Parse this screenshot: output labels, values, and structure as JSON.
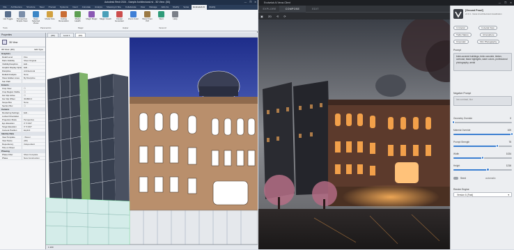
{
  "revit": {
    "title": "Autodesk Revit 2024 - Sample Architectural.rvt - 3D View: {3D}",
    "window_buttons": [
      "—",
      "❐",
      "✕"
    ],
    "tabs": [
      "File",
      "Architecture",
      "Structure",
      "Steel",
      "Precast",
      "Systems",
      "Insert",
      "Annotate",
      "Analyze",
      "Massing & Site",
      "Collaborate",
      "View",
      "Manage",
      "Add-Ins",
      "Modify",
      "Veras",
      "Evolvelab AI",
      "Modify"
    ],
    "active_tab": "Evolvelab AI",
    "ribbon_buttons": [
      {
        "label": "Hot Toggle",
        "color": "#5a6f8d"
      },
      {
        "label": "Perspective Simple View",
        "color": "#7b8ea9"
      },
      {
        "label": "Open Selected Views",
        "color": "#3b86c6"
      },
      {
        "label": "Model Size",
        "color": "#d2a13f"
      },
      {
        "label": "Ceiling Renovation",
        "color": "#c96d34"
      },
      {
        "label": "Model Health",
        "color": "#5d9f52"
      },
      {
        "label": "Magic Magic",
        "color": "#8a57b3"
      },
      {
        "label": "Magic Coach",
        "color": "#4a9fb8"
      },
      {
        "label": "Cluster Generator",
        "color": "#cc4d4d"
      },
      {
        "label": "Zoom Color",
        "color": "#3f7fd6"
      },
      {
        "label": "Show From Pdf",
        "color": "#9b7a45"
      },
      {
        "label": "Start",
        "color": "#2e9b79"
      },
      {
        "label": "Help",
        "color": "#7a7f88"
      }
    ],
    "ribbon_groups": [
      "Tools",
      "Parametrics",
      "Magic",
      "Helper",
      "Veras AI"
    ],
    "properties": {
      "header": "Properties",
      "type_name": "3D View",
      "selector": "3D View: {3D}",
      "edit_type": "Edit Type",
      "groups": [
        {
          "name": "Graphics",
          "rows": [
            [
              "Detail Level",
              "Fine"
            ],
            [
              "Parts Visibility",
              "Show Original"
            ],
            [
              "Visibility/Graphics",
              "Edit..."
            ],
            [
              "Graphic Display Options",
              "Edit..."
            ],
            [
              "Discipline",
              "Architectural"
            ],
            [
              "Default Analysis",
              "None"
            ],
            [
              "Show Hidden Lines",
              "By Discipline"
            ],
            [
              "Sun Path",
              ""
            ]
          ]
        },
        {
          "name": "Extents",
          "rows": [
            [
              "Crop View",
              "☐"
            ],
            [
              "Crop Region Visible",
              "☐"
            ],
            [
              "Far Clip Active",
              "☐"
            ],
            [
              "Far Clip Offset",
              "304800.0"
            ],
            [
              "Scope Box",
              "None"
            ],
            [
              "Section Box",
              "☐"
            ]
          ]
        },
        {
          "name": "Camera",
          "rows": [
            [
              "Rendering Settings",
              "Edit..."
            ],
            [
              "Locked Orientation",
              ""
            ],
            [
              "Projection Mode",
              "Perspective"
            ],
            [
              "Eye Elevation",
              "0' 5 3/32\""
            ],
            [
              "Target Elevation",
              "0' 5 3/32\""
            ],
            [
              "Camera Position",
              "Explicit"
            ]
          ]
        },
        {
          "name": "Identity Data",
          "rows": [
            [
              "View Template",
              "<None>"
            ],
            [
              "View Name",
              "{3D}"
            ],
            [
              "Dependency",
              "Independent"
            ],
            [
              "Title on Sheet",
              ""
            ]
          ]
        },
        {
          "name": "Phasing",
          "rows": [
            [
              "Phase Filter",
              "Show Complete"
            ],
            [
              "Phase",
              "New Construction"
            ]
          ]
        }
      ]
    },
    "view_tabs": [
      "{3D}",
      "Level 1",
      "{3D}"
    ],
    "active_view_tab": 2,
    "status_text": "1:100"
  },
  "ai": {
    "title": "Evolvelab AI Veras Client",
    "window_buttons": [
      "—",
      "❐",
      "✕"
    ],
    "tabs": [
      "EXPLORE",
      "COMPOSE",
      "EDIT"
    ],
    "active_tab": "COMPOSE",
    "toolbar": [
      "▣",
      "2D",
      "⟲",
      "⟳"
    ],
    "panel": {
      "brand": "[Ground Proof]",
      "brand_sub": "v2.3.4 - Veras AI architectural visualization",
      "chips_top": [
        "In Interior",
        "In Aerial View"
      ],
      "chips_mid": [
        "Twilio Nature",
        "Atmosphere"
      ],
      "chips_bot": [
        "Cinematic",
        "Film Photography"
      ],
      "prompt_label": "Prompt",
      "prompt_text": "brick-covered buildings, brick concrete, timber, overcast, black highlights, warm colors, professional photography, aerial",
      "negative_label": "Negative Prompt",
      "negative_placeholder": "low contrast, blur",
      "sliders": [
        {
          "label": "Geometry Override",
          "value": "0",
          "fraction": 0.0
        },
        {
          "label": "Material Override",
          "value": "100",
          "fraction": 1.0
        },
        {
          "label": "Prompt Strength",
          "value": "75",
          "fraction": 0.75
        },
        {
          "label": "Width",
          "value": "1024",
          "fraction": 0.5
        },
        {
          "label": "Height",
          "value": "1216",
          "fraction": 0.59
        }
      ],
      "seed_label": "Seed",
      "seed_value": "automatic",
      "engine_label": "Render Engine",
      "engine_value": "Version 6 (Fast)"
    }
  }
}
